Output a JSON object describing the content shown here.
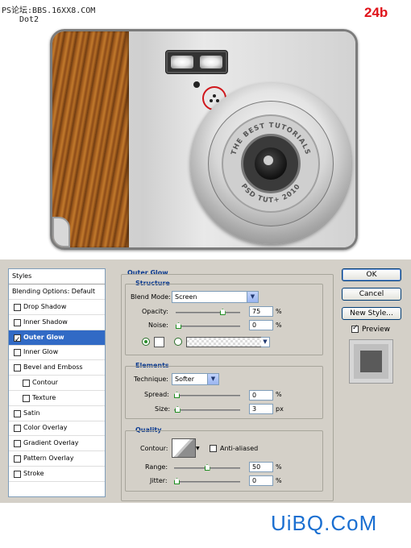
{
  "watermark": "PS论坛:BBS.16XX8.COM",
  "watermark_sub": "Dot2",
  "step_label": "24b",
  "lens": {
    "text_top": "THE BEST TUTORIALS",
    "text_bottom": "PSD TUT+ 2010"
  },
  "styles": {
    "header": "Styles",
    "blending": "Blending Options: Default",
    "items": [
      {
        "label": "Drop Shadow",
        "checked": false,
        "indent": false
      },
      {
        "label": "Inner Shadow",
        "checked": false,
        "indent": false
      },
      {
        "label": "Outer Glow",
        "checked": true,
        "indent": false,
        "selected": true
      },
      {
        "label": "Inner Glow",
        "checked": false,
        "indent": false
      },
      {
        "label": "Bevel and Emboss",
        "checked": false,
        "indent": false
      },
      {
        "label": "Contour",
        "checked": false,
        "indent": true
      },
      {
        "label": "Texture",
        "checked": false,
        "indent": true
      },
      {
        "label": "Satin",
        "checked": false,
        "indent": false
      },
      {
        "label": "Color Overlay",
        "checked": false,
        "indent": false
      },
      {
        "label": "Gradient Overlay",
        "checked": false,
        "indent": false
      },
      {
        "label": "Pattern Overlay",
        "checked": false,
        "indent": false
      },
      {
        "label": "Stroke",
        "checked": false,
        "indent": false
      }
    ]
  },
  "panel": {
    "title": "Outer Glow",
    "structure": {
      "title": "Structure",
      "blend_mode_label": "Blend Mode:",
      "blend_mode_value": "Screen",
      "opacity_label": "Opacity:",
      "opacity_value": "75",
      "opacity_unit": "%",
      "opacity_level": 0.75,
      "noise_label": "Noise:",
      "noise_value": "0",
      "noise_unit": "%",
      "noise_level": 0
    },
    "elements": {
      "title": "Elements",
      "technique_label": "Technique:",
      "technique_value": "Softer",
      "spread_label": "Spread:",
      "spread_value": "0",
      "spread_unit": "%",
      "spread_level": 0,
      "size_label": "Size:",
      "size_value": "3",
      "size_unit": "px",
      "size_level": 0.01
    },
    "quality": {
      "title": "Quality",
      "contour_label": "Contour:",
      "anti_aliased_label": "Anti-aliased",
      "anti_aliased_checked": false,
      "range_label": "Range:",
      "range_value": "50",
      "range_unit": "%",
      "range_level": 0.5,
      "jitter_label": "Jitter:",
      "jitter_value": "0",
      "jitter_unit": "%",
      "jitter_level": 0
    }
  },
  "buttons": {
    "ok": "OK",
    "cancel": "Cancel",
    "new_style": "New Style...",
    "preview_label": "Preview",
    "preview_checked": true
  },
  "footer_logo": "UiBQ.CoM",
  "colors": {
    "accent_red": "#e0141b",
    "selection_blue": "#316ac5",
    "section_title": "#0b3a8f",
    "logo_blue": "#1a6fd1"
  }
}
